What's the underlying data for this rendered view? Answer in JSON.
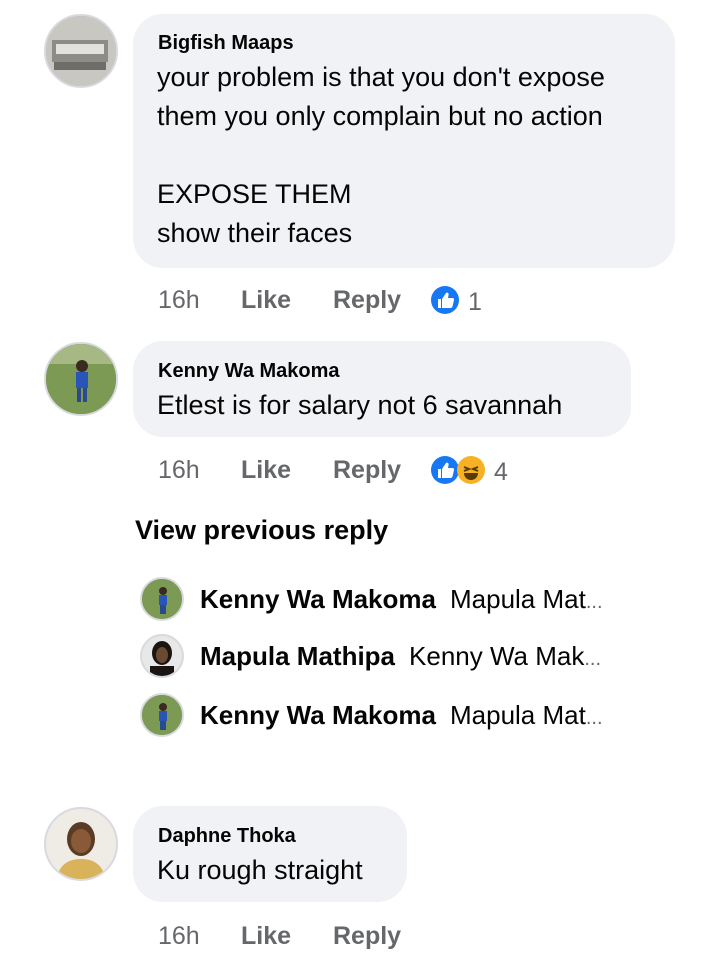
{
  "comments": [
    {
      "author": "Bigfish Maaps",
      "text": "your problem is that you don't expose\nthem you only complain but no action\n\nEXPOSE THEM\nshow their faces",
      "time": "16h",
      "like_label": "Like",
      "reply_label": "Reply",
      "reaction_count": "1",
      "reactions": [
        "like-icon"
      ]
    },
    {
      "author": "Kenny Wa Makoma",
      "text": "Etlest is for salary not  6 savannah",
      "time": "16h",
      "like_label": "Like",
      "reply_label": "Reply",
      "reaction_count": "4",
      "reactions": [
        "like-icon",
        "haha-icon"
      ]
    },
    {
      "author": "Daphne Thoka",
      "text": "Ku rough straight",
      "time": "16h",
      "like_label": "Like",
      "reply_label": "Reply"
    }
  ],
  "view_previous_label": "View previous reply",
  "replies": [
    {
      "author": "Kenny Wa Makoma",
      "snippet": "Mapula Mat",
      "ellipsis": "..."
    },
    {
      "author": "Mapula Mathipa",
      "snippet": "Kenny Wa Mak",
      "ellipsis": "..."
    },
    {
      "author": "Kenny Wa Makoma",
      "snippet": "Mapula Mat",
      "ellipsis": "..."
    }
  ],
  "colors": {
    "bubble": "#f0f2f5",
    "meta_text": "#65676b",
    "like_blue": "#1877f2",
    "haha_yellow": "#f7b125"
  }
}
